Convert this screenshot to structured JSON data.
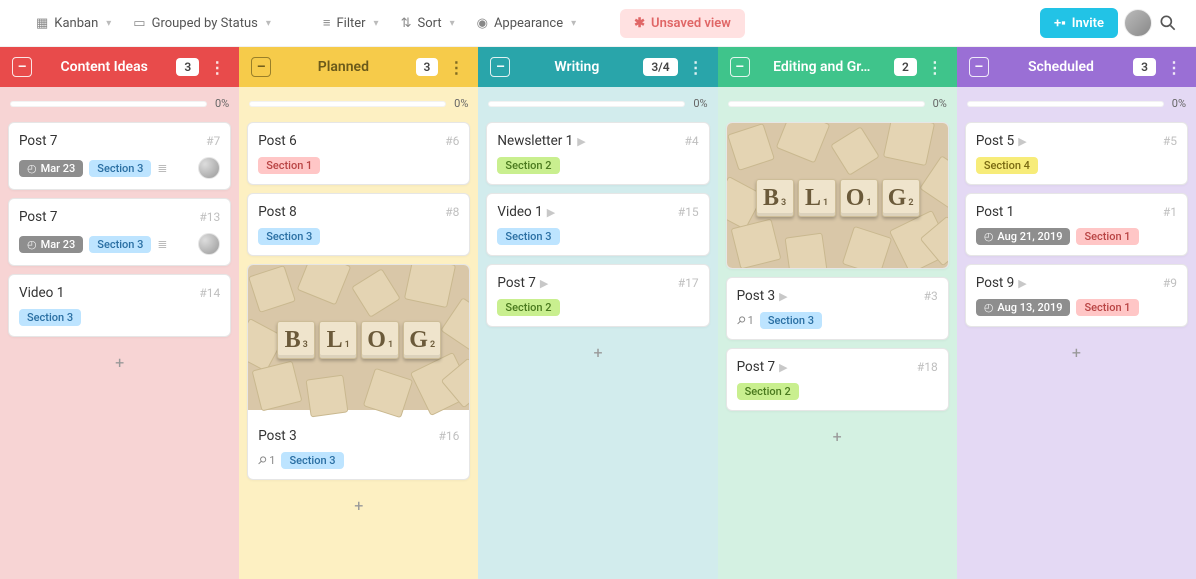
{
  "topbar": {
    "view": "Kanban",
    "group": "Grouped by Status",
    "filter": "Filter",
    "sort": "Sort",
    "appearance": "Appearance",
    "unsaved": "Unsaved view",
    "invite": "Invite"
  },
  "columns": [
    {
      "key": "ideas",
      "title": "Content Ideas",
      "count": "3",
      "progress": "0%",
      "cards": [
        {
          "title": "Post 7",
          "num": "#7",
          "date": "Mar 23",
          "tags": [
            {
              "t": "Section 3",
              "c": "blue"
            }
          ],
          "lines": true,
          "assignee": true
        },
        {
          "title": "Post 7",
          "num": "#13",
          "date": "Mar 23",
          "tags": [
            {
              "t": "Section 3",
              "c": "blue"
            }
          ],
          "lines": true,
          "assignee": true
        },
        {
          "title": "Video 1",
          "num": "#14",
          "tags": [
            {
              "t": "Section 3",
              "c": "blue"
            }
          ]
        }
      ]
    },
    {
      "key": "planned",
      "title": "Planned",
      "count": "3",
      "progress": "0%",
      "cards": [
        {
          "title": "Post 6",
          "num": "#6",
          "tags": [
            {
              "t": "Section 1",
              "c": "red"
            }
          ]
        },
        {
          "title": "Post 8",
          "num": "#8",
          "tags": [
            {
              "t": "Section 3",
              "c": "blue"
            }
          ]
        },
        {
          "image": true,
          "letters": "BLOG",
          "title": "Post 3",
          "num": "#16",
          "attach": "1",
          "tags": [
            {
              "t": "Section 3",
              "c": "blue"
            }
          ]
        }
      ]
    },
    {
      "key": "writing",
      "title": "Writing",
      "count": "3/4",
      "progress": "0%",
      "cards": [
        {
          "title": "Newsletter 1",
          "play": true,
          "num": "#4",
          "tags": [
            {
              "t": "Section 2",
              "c": "green"
            }
          ]
        },
        {
          "title": "Video 1",
          "play": true,
          "num": "#15",
          "tags": [
            {
              "t": "Section 3",
              "c": "blue"
            }
          ]
        },
        {
          "title": "Post 7",
          "play": true,
          "num": "#17",
          "tags": [
            {
              "t": "Section 2",
              "c": "green"
            }
          ]
        }
      ]
    },
    {
      "key": "editing",
      "title": "Editing and Gr…",
      "count": "2",
      "progress": "0%",
      "cards": [
        {
          "imageOnly": true,
          "letters": "BLOG"
        },
        {
          "title": "Post 3",
          "play": true,
          "num": "#3",
          "attach": "1",
          "tags": [
            {
              "t": "Section 3",
              "c": "blue"
            }
          ]
        },
        {
          "title": "Post 7",
          "play": true,
          "num": "#18",
          "tags": [
            {
              "t": "Section 2",
              "c": "green"
            }
          ]
        }
      ]
    },
    {
      "key": "scheduled",
      "title": "Scheduled",
      "count": "3",
      "progress": "0%",
      "cards": [
        {
          "title": "Post 5",
          "play": true,
          "num": "#5",
          "tags": [
            {
              "t": "Section 4",
              "c": "yellow"
            }
          ]
        },
        {
          "title": "Post 1",
          "num": "#1",
          "date": "Aug 21, 2019",
          "tags": [
            {
              "t": "Section 1",
              "c": "red"
            }
          ]
        },
        {
          "title": "Post 9",
          "play": true,
          "num": "#9",
          "date": "Aug 13, 2019",
          "tags": [
            {
              "t": "Section 1",
              "c": "red"
            }
          ]
        }
      ]
    }
  ]
}
